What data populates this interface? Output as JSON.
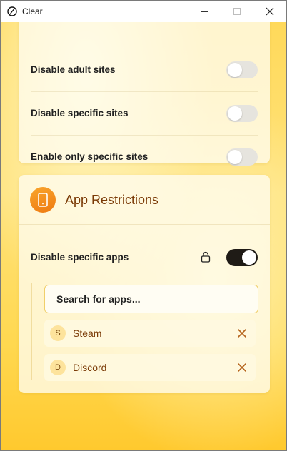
{
  "window": {
    "title": "Clear",
    "accent": "#ee7a11"
  },
  "web_card": {
    "rows": [
      {
        "label": "Disable adult sites",
        "on": false
      },
      {
        "label": "Disable specific sites",
        "on": false
      },
      {
        "label": "Enable only specific sites",
        "on": false
      }
    ]
  },
  "app_card": {
    "title": "App Restrictions",
    "icon": "phone-icon",
    "row": {
      "label": "Disable specific apps",
      "on": true,
      "lock_icon": "unlock-icon"
    },
    "search": {
      "placeholder": "Search for apps...",
      "value": ""
    },
    "apps": [
      {
        "initial": "S",
        "name": "Steam"
      },
      {
        "initial": "D",
        "name": "Discord"
      }
    ]
  }
}
